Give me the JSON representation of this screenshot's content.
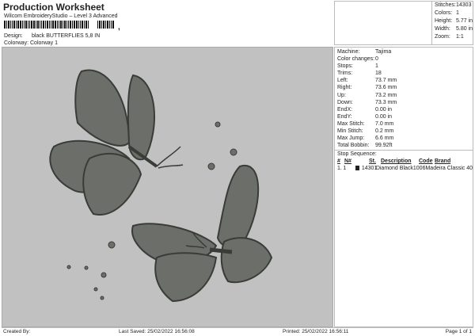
{
  "header": {
    "title": "Production Worksheet",
    "subtitle": "Wilcom EmbroideryStudio – Level 3 Advanced",
    "barcode_suffix": ",",
    "design_label": "Design:",
    "design_value": "black BUTTERFLIES 5,8 IN",
    "colorway_label": "Colorway:",
    "colorway_value": "Colorway 1"
  },
  "stats": [
    {
      "label": "Stitches:",
      "value": "14303"
    },
    {
      "label": "Colors:",
      "value": "1"
    },
    {
      "label": "Height:",
      "value": "5.77 in"
    },
    {
      "label": "Width:",
      "value": "5.80 in"
    },
    {
      "label": "Zoom:",
      "value": "1:1"
    }
  ],
  "details": [
    {
      "label": "Machine:",
      "value": "Tajima"
    },
    {
      "label": "Color changes:",
      "value": "0"
    },
    {
      "label": "Stops:",
      "value": "1"
    },
    {
      "label": "Trims:",
      "value": "18"
    },
    {
      "label": "Left:",
      "value": "73.7 mm"
    },
    {
      "label": "Right:",
      "value": "73.6 mm"
    },
    {
      "label": "Up:",
      "value": "73.2 mm"
    },
    {
      "label": "Down:",
      "value": "73.3 mm"
    },
    {
      "label": "EndX:",
      "value": "0.00 in"
    },
    {
      "label": "EndY:",
      "value": "0.00 in"
    },
    {
      "label": "Max Stitch:",
      "value": "7.0 mm"
    },
    {
      "label": "Min Stitch:",
      "value": "0.2 mm"
    },
    {
      "label": "Max Jump:",
      "value": "6.6 mm"
    },
    {
      "label": "Total Bobbin:",
      "value": "99.92ft"
    }
  ],
  "stop_sequence": {
    "title": "Stop Sequence:",
    "headers": [
      "#",
      "N#",
      "St.",
      "Description",
      "Code",
      "Brand"
    ],
    "rows": [
      {
        "num": "1.",
        "n": "1",
        "color": "#222222",
        "st": "14301",
        "desc": "Diamond Black",
        "code": "1006",
        "brand": "Madeira Classic 40"
      }
    ]
  },
  "footer": {
    "created_by": "Created By:",
    "last_saved": "Last Saved: 25/02/2022 16:56:08",
    "printed": "Printed: 25/02/2022 16:56:11",
    "page": "Page 1 of 1"
  }
}
